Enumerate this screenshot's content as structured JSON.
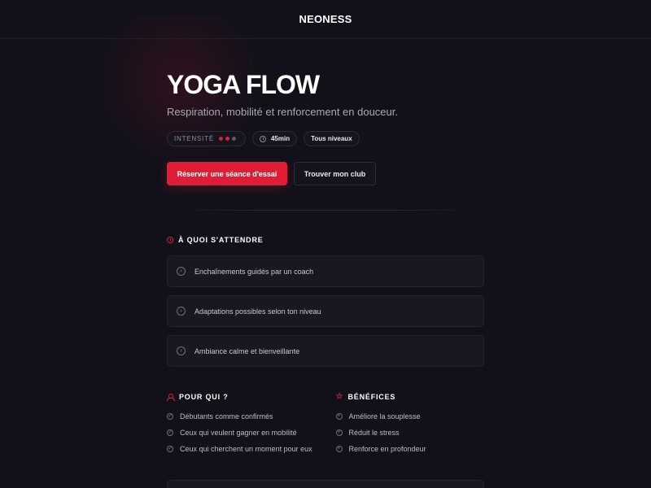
{
  "header": {
    "brand": "NEONESS"
  },
  "hero": {
    "title": "YOGA FLOW",
    "subtitle": "Respiration, mobilité et renforcement en douceur.",
    "chips": {
      "intensity_label": "INTENSITÉ",
      "intensity_level": 2,
      "intensity_max": 3,
      "duration": "45min",
      "level": "Tous niveaux"
    },
    "primary_cta": "Réserver une séance d'essai",
    "secondary_cta": "Trouver mon club"
  },
  "expect": {
    "title": "À QUOI S'ATTENDRE",
    "items": [
      "Enchaînements guidés par un coach",
      "Adaptations possibles selon ton niveau",
      "Ambiance calme et bienveillante"
    ]
  },
  "for_who": {
    "title": "POUR QUI ?",
    "items": [
      "Débutants comme confirmés",
      "Ceux qui veulent gagner en mobilité",
      "Ceux qui cherchent un moment pour eux"
    ]
  },
  "benefits": {
    "title": "BÉNÉFICES",
    "items": [
      "Améliore la souplesse",
      "Réduit le stress",
      "Renforce en profondeur"
    ]
  },
  "colors": {
    "accent": "#e11d35",
    "background": "#12111a",
    "card": "#181722",
    "dot_inactive": "#5b5a66"
  },
  "icons": {
    "duration": "clock-icon",
    "expect": "info-circle-icon",
    "for_who": "user-icon",
    "benefits": "star-icon",
    "expect_item": "chevron-circle-icon",
    "list_item": "check-circle-icon",
    "benefit_item": "plus-circle-icon"
  }
}
